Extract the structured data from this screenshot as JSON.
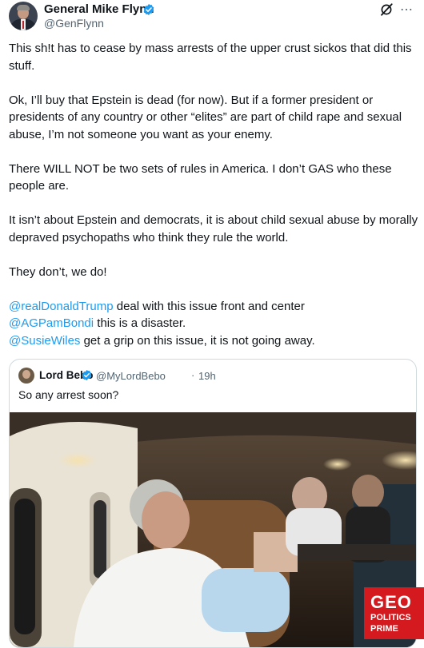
{
  "author": {
    "name": "General Mike Flynn",
    "handle": "@GenFlynn"
  },
  "icons": {
    "verified": "verified-badge-icon",
    "grok": "grok-icon",
    "more": "more-options-icon"
  },
  "tweet": {
    "paragraphs": [
      "This sh!t has to cease by mass arrests of the upper crust sickos that did this stuff.",
      "Ok, I’ll buy that Epstein is dead (for now). But if a former president or presidents of any country or other “elites” are part of child rape and sexual abuse, I’m not someone you want as your enemy.",
      "There WILL NOT be two sets of rules in America. I don’t GAS who these people are.",
      "It isn’t about Epstein and democrats, it is about child sexual abuse by morally depraved psychopaths who think they rule the world.",
      "They don’t, we do!"
    ],
    "mention_lines": [
      {
        "mention": "@realDonaldTrump",
        "text": " deal with this issue front and center"
      },
      {
        "mention": "@AGPamBondi",
        "text": " this is a disaster."
      },
      {
        "mention": "@SusieWiles",
        "text": " get a grip on this issue, it is not going away."
      }
    ]
  },
  "quoted": {
    "name": "Lord Bebo",
    "handle": "@MyLordBebo",
    "dot": "·",
    "time": "19h",
    "text": "So any arrest soon?"
  },
  "watermark": {
    "line1": "GEO",
    "line2": "POLITICS",
    "line3": "PRIME"
  },
  "colors": {
    "link": "#1d9bf0",
    "verified": "#1d9bf0",
    "secondary_text": "#536471",
    "watermark_bg": "#d41a1f"
  }
}
